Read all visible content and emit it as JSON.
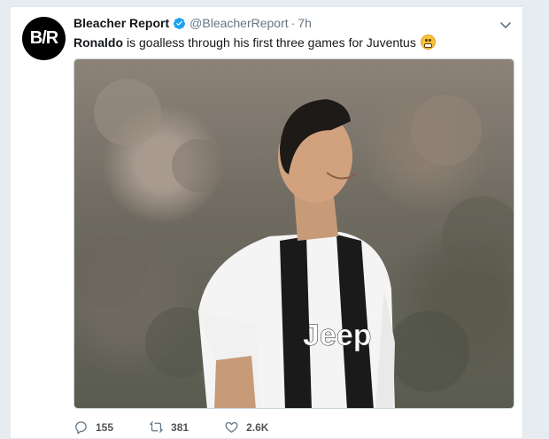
{
  "tweet": {
    "avatar_text": "B/R",
    "author_name": "Bleacher Report",
    "handle": "@BleacherReport",
    "separator": "·",
    "time": "7h",
    "text_bold": "Ronaldo",
    "text_rest": "is goalless through his first three games for Juventus",
    "emoji": "grimacing-face",
    "photo_subject": "player"
  },
  "actions": {
    "replies": "155",
    "retweets": "381",
    "likes": "2.6K"
  },
  "colors": {
    "verified": "#1da1f2",
    "muted": "#657786",
    "page_bg": "#e6ecf0"
  }
}
